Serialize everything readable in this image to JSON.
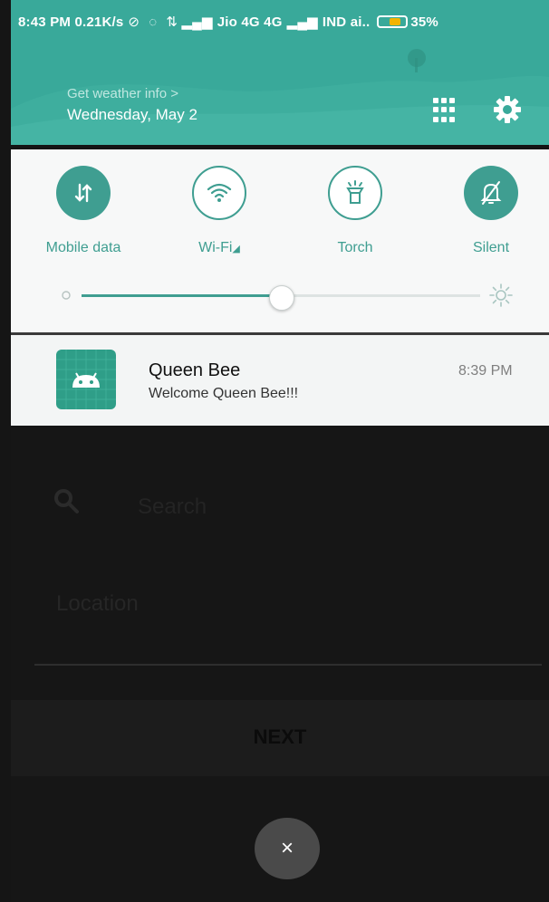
{
  "status_bar": {
    "time": "8:43 PM",
    "speed": "0.21K/s",
    "carrier1": "Jio 4G 4G",
    "carrier2": "IND ai..",
    "battery": "35%"
  },
  "header": {
    "weather_link": "Get weather info >",
    "date": "Wednesday, May 2",
    "grid_icon": "grid-icon",
    "settings_icon": "gear-icon"
  },
  "quick_settings": {
    "tiles": [
      {
        "label": "Mobile data",
        "icon": "mobile-data-icon",
        "state": "on"
      },
      {
        "label": "Wi-Fi",
        "icon": "wifi-icon",
        "state": "off"
      },
      {
        "label": "Torch",
        "icon": "torch-icon",
        "state": "off"
      },
      {
        "label": "Silent",
        "icon": "silent-bell-icon",
        "state": "on"
      }
    ],
    "brightness_level": 0.5,
    "accent": "#3f9e91"
  },
  "notification": {
    "title": "Queen Bee",
    "text": "Welcome Queen Bee!!!",
    "time": "8:39 PM",
    "icon": "android-icon",
    "icon_color": "#2f9e88"
  },
  "background_app": {
    "search_placeholder": "Search",
    "location_label": "Location",
    "next_label": "NEXT"
  },
  "close_symbol": "×"
}
